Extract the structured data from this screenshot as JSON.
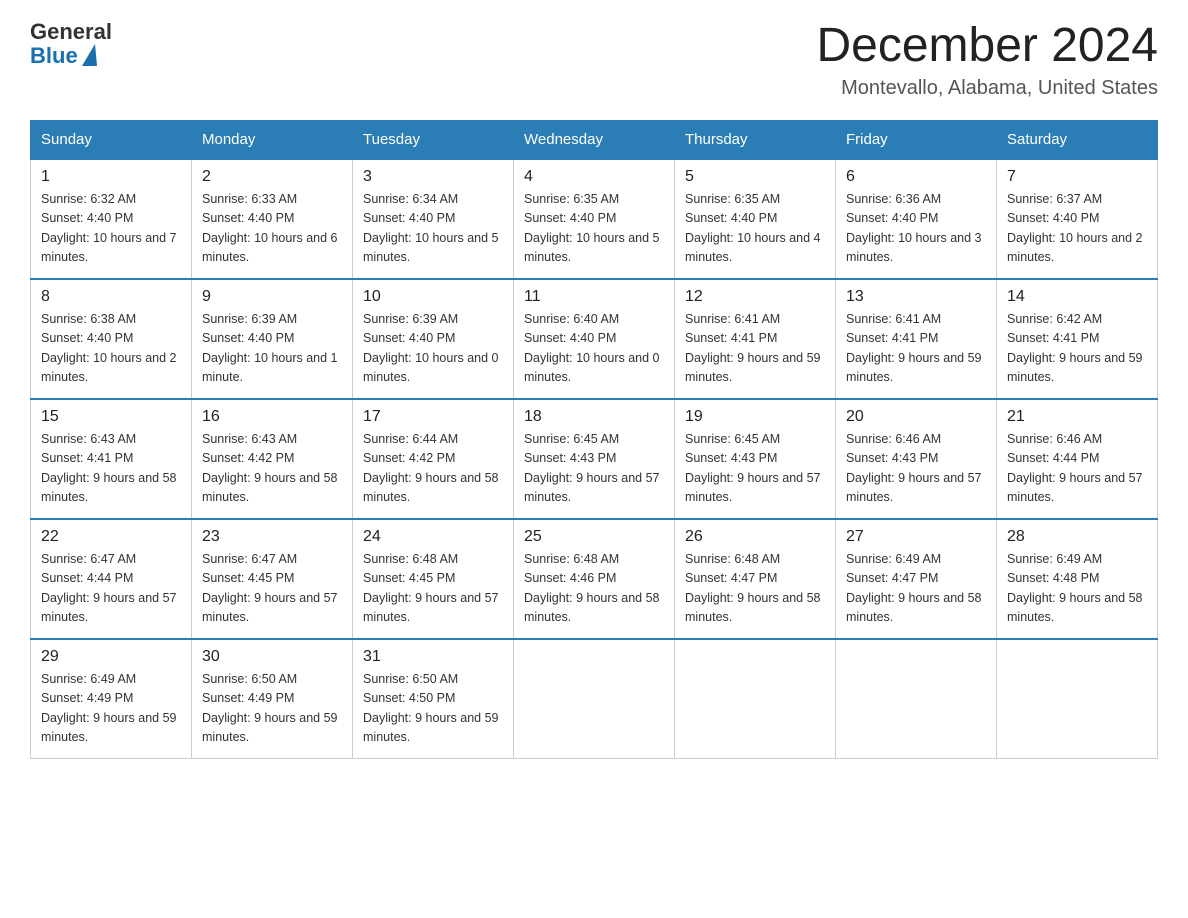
{
  "header": {
    "logo": {
      "general": "General",
      "blue": "Blue"
    },
    "title": "December 2024",
    "location": "Montevallo, Alabama, United States"
  },
  "calendar": {
    "days_of_week": [
      "Sunday",
      "Monday",
      "Tuesday",
      "Wednesday",
      "Thursday",
      "Friday",
      "Saturday"
    ],
    "weeks": [
      [
        {
          "day": "1",
          "sunrise": "6:32 AM",
          "sunset": "4:40 PM",
          "daylight": "10 hours and 7 minutes."
        },
        {
          "day": "2",
          "sunrise": "6:33 AM",
          "sunset": "4:40 PM",
          "daylight": "10 hours and 6 minutes."
        },
        {
          "day": "3",
          "sunrise": "6:34 AM",
          "sunset": "4:40 PM",
          "daylight": "10 hours and 5 minutes."
        },
        {
          "day": "4",
          "sunrise": "6:35 AM",
          "sunset": "4:40 PM",
          "daylight": "10 hours and 5 minutes."
        },
        {
          "day": "5",
          "sunrise": "6:35 AM",
          "sunset": "4:40 PM",
          "daylight": "10 hours and 4 minutes."
        },
        {
          "day": "6",
          "sunrise": "6:36 AM",
          "sunset": "4:40 PM",
          "daylight": "10 hours and 3 minutes."
        },
        {
          "day": "7",
          "sunrise": "6:37 AM",
          "sunset": "4:40 PM",
          "daylight": "10 hours and 2 minutes."
        }
      ],
      [
        {
          "day": "8",
          "sunrise": "6:38 AM",
          "sunset": "4:40 PM",
          "daylight": "10 hours and 2 minutes."
        },
        {
          "day": "9",
          "sunrise": "6:39 AM",
          "sunset": "4:40 PM",
          "daylight": "10 hours and 1 minute."
        },
        {
          "day": "10",
          "sunrise": "6:39 AM",
          "sunset": "4:40 PM",
          "daylight": "10 hours and 0 minutes."
        },
        {
          "day": "11",
          "sunrise": "6:40 AM",
          "sunset": "4:40 PM",
          "daylight": "10 hours and 0 minutes."
        },
        {
          "day": "12",
          "sunrise": "6:41 AM",
          "sunset": "4:41 PM",
          "daylight": "9 hours and 59 minutes."
        },
        {
          "day": "13",
          "sunrise": "6:41 AM",
          "sunset": "4:41 PM",
          "daylight": "9 hours and 59 minutes."
        },
        {
          "day": "14",
          "sunrise": "6:42 AM",
          "sunset": "4:41 PM",
          "daylight": "9 hours and 59 minutes."
        }
      ],
      [
        {
          "day": "15",
          "sunrise": "6:43 AM",
          "sunset": "4:41 PM",
          "daylight": "9 hours and 58 minutes."
        },
        {
          "day": "16",
          "sunrise": "6:43 AM",
          "sunset": "4:42 PM",
          "daylight": "9 hours and 58 minutes."
        },
        {
          "day": "17",
          "sunrise": "6:44 AM",
          "sunset": "4:42 PM",
          "daylight": "9 hours and 58 minutes."
        },
        {
          "day": "18",
          "sunrise": "6:45 AM",
          "sunset": "4:43 PM",
          "daylight": "9 hours and 57 minutes."
        },
        {
          "day": "19",
          "sunrise": "6:45 AM",
          "sunset": "4:43 PM",
          "daylight": "9 hours and 57 minutes."
        },
        {
          "day": "20",
          "sunrise": "6:46 AM",
          "sunset": "4:43 PM",
          "daylight": "9 hours and 57 minutes."
        },
        {
          "day": "21",
          "sunrise": "6:46 AM",
          "sunset": "4:44 PM",
          "daylight": "9 hours and 57 minutes."
        }
      ],
      [
        {
          "day": "22",
          "sunrise": "6:47 AM",
          "sunset": "4:44 PM",
          "daylight": "9 hours and 57 minutes."
        },
        {
          "day": "23",
          "sunrise": "6:47 AM",
          "sunset": "4:45 PM",
          "daylight": "9 hours and 57 minutes."
        },
        {
          "day": "24",
          "sunrise": "6:48 AM",
          "sunset": "4:45 PM",
          "daylight": "9 hours and 57 minutes."
        },
        {
          "day": "25",
          "sunrise": "6:48 AM",
          "sunset": "4:46 PM",
          "daylight": "9 hours and 58 minutes."
        },
        {
          "day": "26",
          "sunrise": "6:48 AM",
          "sunset": "4:47 PM",
          "daylight": "9 hours and 58 minutes."
        },
        {
          "day": "27",
          "sunrise": "6:49 AM",
          "sunset": "4:47 PM",
          "daylight": "9 hours and 58 minutes."
        },
        {
          "day": "28",
          "sunrise": "6:49 AM",
          "sunset": "4:48 PM",
          "daylight": "9 hours and 58 minutes."
        }
      ],
      [
        {
          "day": "29",
          "sunrise": "6:49 AM",
          "sunset": "4:49 PM",
          "daylight": "9 hours and 59 minutes."
        },
        {
          "day": "30",
          "sunrise": "6:50 AM",
          "sunset": "4:49 PM",
          "daylight": "9 hours and 59 minutes."
        },
        {
          "day": "31",
          "sunrise": "6:50 AM",
          "sunset": "4:50 PM",
          "daylight": "9 hours and 59 minutes."
        },
        null,
        null,
        null,
        null
      ]
    ]
  }
}
